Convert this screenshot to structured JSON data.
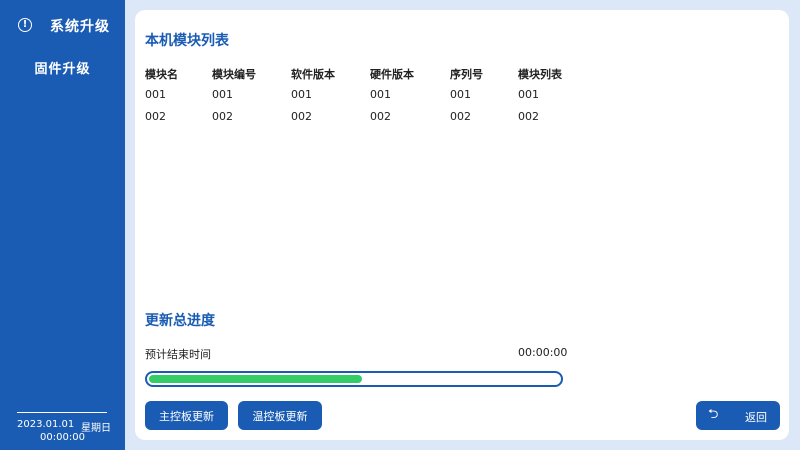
{
  "sidebar": {
    "title": "系统升级",
    "items": [
      {
        "label": "固件升级"
      }
    ],
    "datetime": {
      "date": "2023.01.01",
      "weekday": "星期日",
      "time": "00:00:00"
    }
  },
  "module_list": {
    "title": "本机模块列表",
    "columns": [
      "模块名",
      "模块编号",
      "软件版本",
      "硬件版本",
      "序列号",
      "模块列表"
    ],
    "rows": [
      [
        "001",
        "001",
        "001",
        "001",
        "001",
        "001"
      ],
      [
        "002",
        "002",
        "002",
        "002",
        "002",
        "002"
      ]
    ]
  },
  "progress": {
    "title": "更新总进度",
    "estimate_label": "预计结束时间",
    "estimate_value": "00:00:00",
    "fraction": 0.52
  },
  "buttons": {
    "main_board": "主控板更新",
    "temp_board": "温控板更新",
    "back": "返回"
  },
  "colors": {
    "sidebar_bg": "#1a5cb3",
    "accent": "#1a5cb3",
    "progress_fill": "#33cc66",
    "page_bg": "#dce8f7"
  },
  "icons": {
    "header_icon": "info-circle-icon",
    "back_icon": "return-arrow-icon"
  }
}
